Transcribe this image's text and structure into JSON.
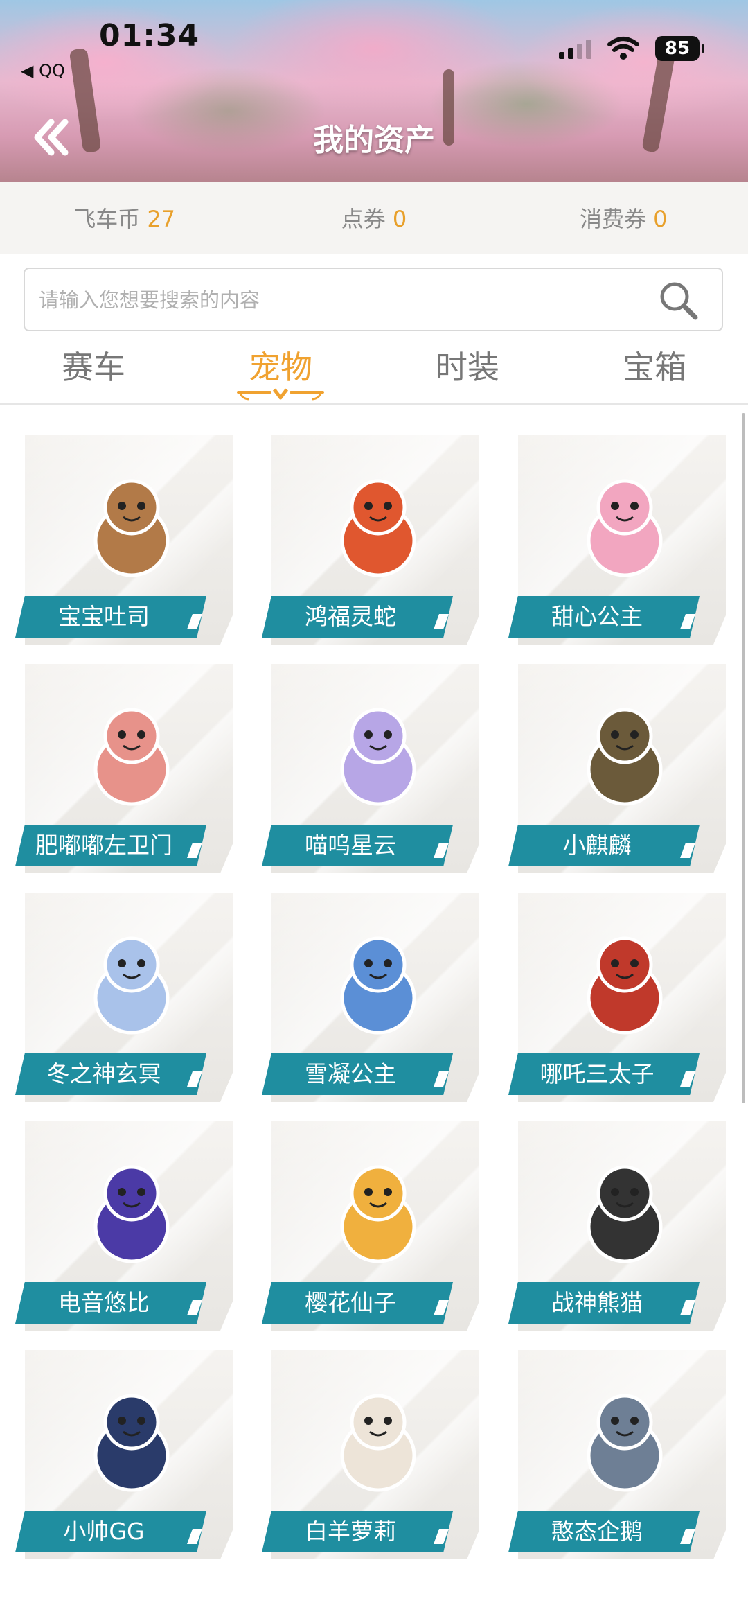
{
  "status_bar": {
    "time": "01:34",
    "back_app": "◀ QQ",
    "battery": "85"
  },
  "header": {
    "title": "我的资产"
  },
  "currency": [
    {
      "label": "飞车币",
      "value": "27"
    },
    {
      "label": "点券",
      "value": "0"
    },
    {
      "label": "消费券",
      "value": "0"
    }
  ],
  "search": {
    "placeholder": "请输入您想要搜索的内容",
    "value": ""
  },
  "tabs": [
    {
      "label": "赛车",
      "active": false
    },
    {
      "label": "宠物",
      "active": true
    },
    {
      "label": "时装",
      "active": false
    },
    {
      "label": "宝箱",
      "active": false
    }
  ],
  "pets": [
    {
      "name": "宝宝吐司",
      "icon": "toast-pet-icon",
      "color": "#b27a48"
    },
    {
      "name": "鸿福灵蛇",
      "icon": "snake-pet-icon",
      "color": "#e0572f"
    },
    {
      "name": "甜心公主",
      "icon": "princess-pet-icon",
      "color": "#f2a6c0"
    },
    {
      "name": "肥嘟嘟左卫门",
      "icon": "pig-pet-icon",
      "color": "#e7928a"
    },
    {
      "name": "喵呜星云",
      "icon": "cat-cloud-pet-icon",
      "color": "#b7a6e6"
    },
    {
      "name": "小麒麟",
      "icon": "qilin-pet-icon",
      "color": "#6b5a3a"
    },
    {
      "name": "冬之神玄冥",
      "icon": "winter-god-pet-icon",
      "color": "#a9c2ea"
    },
    {
      "name": "雪凝公主",
      "icon": "snow-princess-pet-icon",
      "color": "#5b8fd6"
    },
    {
      "name": "哪吒三太子",
      "icon": "nezha-pet-icon",
      "color": "#c0392b"
    },
    {
      "name": "电音悠比",
      "icon": "music-pet-icon",
      "color": "#4b3aa6"
    },
    {
      "name": "樱花仙子",
      "icon": "sakura-fairy-pet-icon",
      "color": "#f0b03e"
    },
    {
      "name": "战神熊猫",
      "icon": "panda-pet-icon",
      "color": "#333333"
    },
    {
      "name": "小帅GG",
      "icon": "boy-pet-icon",
      "color": "#2a3b6a"
    },
    {
      "name": "白羊萝莉",
      "icon": "sheep-pet-icon",
      "color": "#ede4d8"
    },
    {
      "name": "憨态企鹅",
      "icon": "penguin-pet-icon",
      "color": "#6e7f95"
    }
  ],
  "colors": {
    "accent": "#f0a230",
    "label_bg": "#1f8ea0",
    "currency_value": "#e8a02b"
  }
}
